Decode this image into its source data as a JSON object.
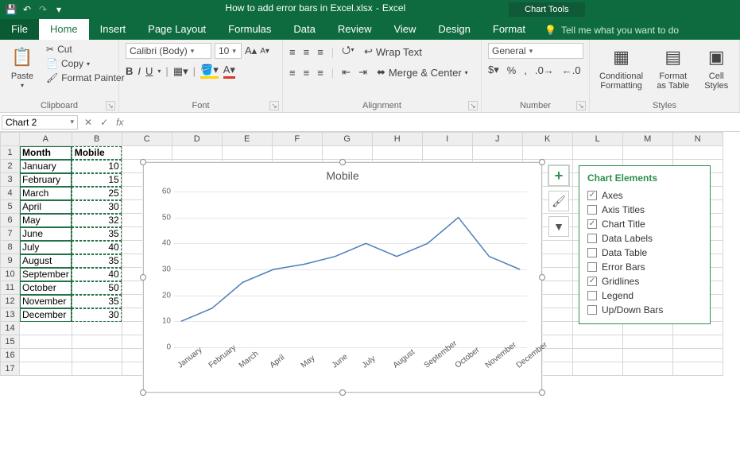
{
  "qat": {
    "save": "💾",
    "undo": "↶",
    "redo": "↷"
  },
  "title": {
    "filename": "How to add error bars in Excel.xlsx",
    "app": "Excel",
    "tooltab": "Chart Tools"
  },
  "tabs": [
    "File",
    "Home",
    "Insert",
    "Page Layout",
    "Formulas",
    "Data",
    "Review",
    "View",
    "Design",
    "Format"
  ],
  "active_tab": "Home",
  "tellme": "Tell me what you want to do",
  "ribbon": {
    "clipboard": {
      "paste": "Paste",
      "cut": "Cut",
      "copy": "Copy",
      "painter": "Format Painter",
      "label": "Clipboard"
    },
    "font": {
      "name": "Calibri (Body)",
      "size": "10",
      "bold": "B",
      "italic": "I",
      "underline": "U",
      "label": "Font"
    },
    "alignment": {
      "wrap": "Wrap Text",
      "merge": "Merge & Center",
      "label": "Alignment"
    },
    "number": {
      "format": "General",
      "label": "Number"
    },
    "styles": {
      "cond": "Conditional Formatting",
      "table": "Format as Table",
      "cell": "Cell Styles",
      "label": "Styles"
    }
  },
  "namebox": "Chart 2",
  "fx_label": "fx",
  "columns": [
    "A",
    "B",
    "C",
    "D",
    "E",
    "F",
    "G",
    "H",
    "I",
    "J",
    "K",
    "L",
    "M",
    "N"
  ],
  "rows": 17,
  "table": {
    "headers": [
      "Month",
      "Mobile"
    ],
    "data": [
      [
        "January",
        10
      ],
      [
        "February",
        15
      ],
      [
        "March",
        25
      ],
      [
        "April",
        30
      ],
      [
        "May",
        32
      ],
      [
        "June",
        35
      ],
      [
        "July",
        40
      ],
      [
        "August",
        35
      ],
      [
        "September",
        40
      ],
      [
        "October",
        50
      ],
      [
        "November",
        35
      ],
      [
        "December",
        30
      ]
    ]
  },
  "chart_data": {
    "type": "line",
    "title": "Mobile",
    "categories": [
      "January",
      "February",
      "March",
      "April",
      "May",
      "June",
      "July",
      "August",
      "September",
      "October",
      "November",
      "December"
    ],
    "values": [
      10,
      15,
      25,
      30,
      32,
      35,
      40,
      35,
      40,
      50,
      35,
      30
    ],
    "ylim": [
      0,
      60
    ],
    "yticks": [
      0,
      10,
      20,
      30,
      40,
      50,
      60
    ],
    "xlabel": "",
    "ylabel": ""
  },
  "chart_elements": {
    "title": "Chart Elements",
    "items": [
      {
        "label": "Axes",
        "checked": true
      },
      {
        "label": "Axis Titles",
        "checked": false
      },
      {
        "label": "Chart Title",
        "checked": true
      },
      {
        "label": "Data Labels",
        "checked": false
      },
      {
        "label": "Data Table",
        "checked": false
      },
      {
        "label": "Error Bars",
        "checked": false
      },
      {
        "label": "Gridlines",
        "checked": true
      },
      {
        "label": "Legend",
        "checked": false
      },
      {
        "label": "Up/Down Bars",
        "checked": false
      }
    ]
  }
}
